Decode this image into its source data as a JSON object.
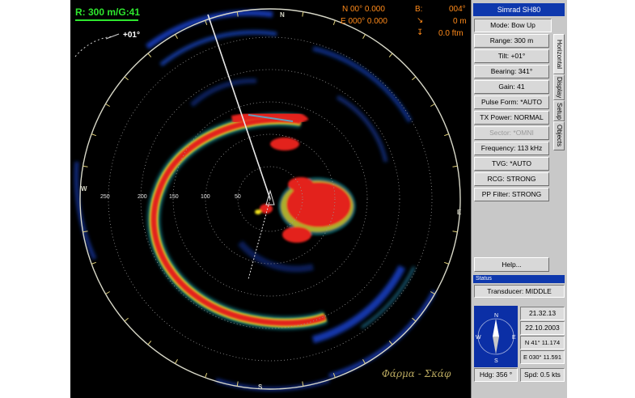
{
  "hud": {
    "range_readout": "R:  300 m/G:41",
    "tilt_label": "+01°",
    "position": {
      "lat": "N  00° 0.000",
      "lon": "E 000° 0.000",
      "b_label": "B:",
      "b_value": "004°",
      "depth1": "0 m",
      "depth2": "0.0 ftm"
    },
    "range_rings": [
      "250",
      "200",
      "150",
      "100",
      "50"
    ],
    "compass_letters": {
      "n": "N",
      "s": "S",
      "e": "E",
      "w": "W"
    }
  },
  "panel": {
    "title": "Simrad SH80",
    "mode": "Mode: Bow Up",
    "buttons": [
      {
        "label": "Range: 300 m",
        "enabled": true
      },
      {
        "label": "Tilt: +01°",
        "enabled": true
      },
      {
        "label": "Bearing: 341°",
        "enabled": true
      },
      {
        "label": "Gain: 41",
        "enabled": true
      },
      {
        "label": "Pulse Form: *AUTO",
        "enabled": true
      },
      {
        "label": "TX Power: NORMAL",
        "enabled": true
      },
      {
        "label": "Sector: *OMNI",
        "enabled": false
      },
      {
        "label": "Frequency: 113 kHz",
        "enabled": true
      },
      {
        "label": "TVG: *AUTO",
        "enabled": true
      },
      {
        "label": "RCG: STRONG",
        "enabled": true
      },
      {
        "label": "PP Filter: STRONG",
        "enabled": true
      }
    ],
    "help": "Help...",
    "tabs": [
      "Horizontal",
      "Display",
      "Setup",
      "Objects"
    ],
    "status_title": "Status",
    "transducer": "Transducer: MIDDLE",
    "time": "21.32.13",
    "date": "22.10.2003",
    "lat": "N  41° 11.174",
    "lon": "E 030° 11.591",
    "heading": "Hdg: 356 °",
    "speed": "Spd: 0.5 kts"
  },
  "watermark": "Φάρμα - Σκάφ",
  "colors": {
    "accent": "#0e38ad",
    "hud_green": "#2ee62e",
    "hud_orange": "#ff8a1a",
    "echo_red": "#e8201a"
  }
}
